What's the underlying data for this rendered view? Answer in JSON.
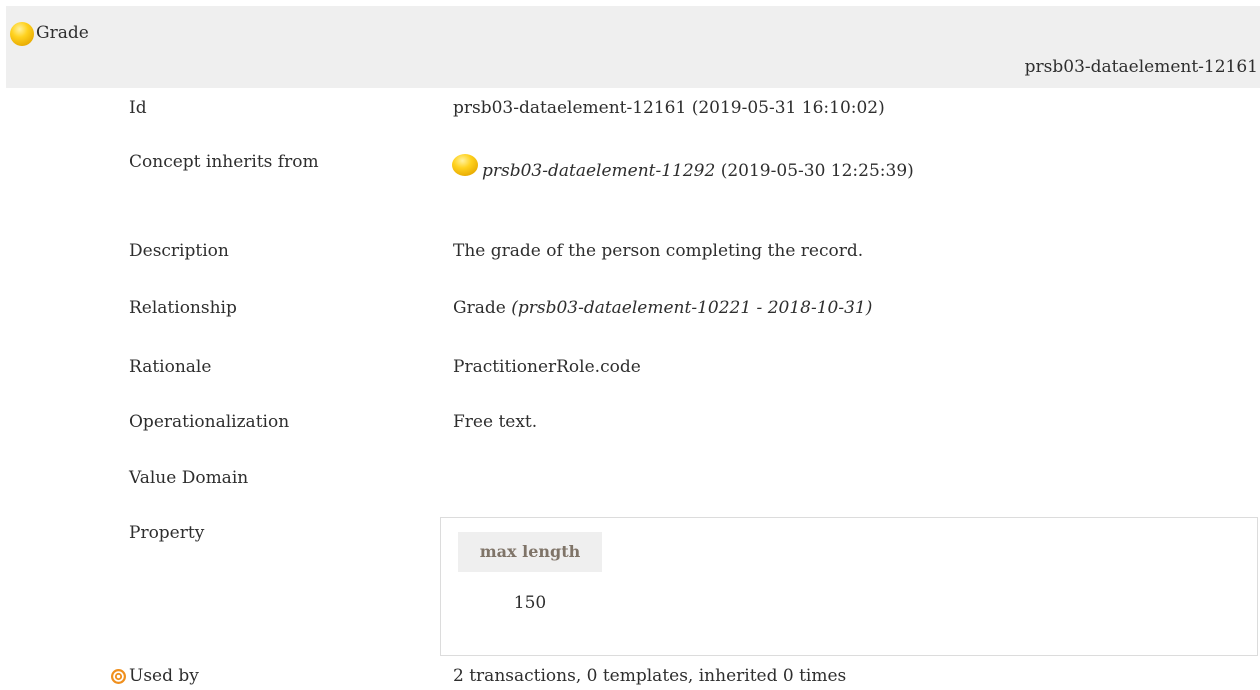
{
  "header": {
    "title": "Grade",
    "id": "prsb03-dataelement-12161",
    "icon": "yellow-ball-icon"
  },
  "rows": {
    "id": {
      "label": "Id",
      "value": "prsb03-dataelement-12161 (2019-05-31 16:10:02)"
    },
    "inherits": {
      "label": "Concept inherits from",
      "link": "prsb03-dataelement-11292",
      "date": " (2019-05-30 12:25:39)",
      "icon": "yellow-ball-icon"
    },
    "description": {
      "label": "Description",
      "value": "The grade of the person completing the record."
    },
    "relationship": {
      "label": "Relationship",
      "name": "Grade ",
      "ref": "(prsb03-dataelement-10221 - 2018-10-31)"
    },
    "rationale": {
      "label": "Rationale",
      "value": "PractitionerRole.code"
    },
    "operationalization": {
      "label": "Operationalization",
      "value": "Free text."
    },
    "value_domain": {
      "label": "Value Domain"
    },
    "property": {
      "label": "Property",
      "header": "max length",
      "value": "150"
    },
    "used_by": {
      "label": "Used by",
      "value": "2 transactions, 0 templates, inherited 0 times",
      "icon": "target-icon"
    }
  },
  "colors": {
    "yellow_ball": "#f5c400",
    "target": "#f0901e",
    "header_bg": "#efefef",
    "prop_header_text": "#7f7468"
  }
}
